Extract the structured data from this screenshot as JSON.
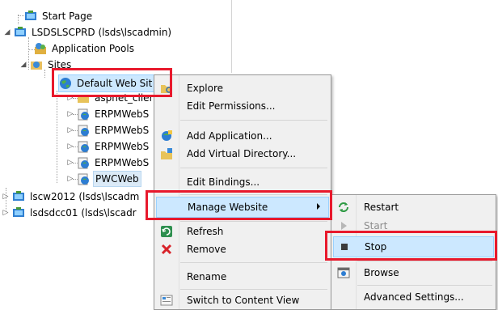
{
  "tree": {
    "start_page": "Start Page",
    "server": "LSDSLSCPRD (lsds\\lscadmin)",
    "app_pools": "Application Pools",
    "sites": "Sites",
    "default_site": "Default Web Sit",
    "child_aspnet": "aspnet_clier",
    "erpm1": "ERPMWebS",
    "erpm2": "ERPMWebS",
    "erpm3": "ERPMWebS",
    "erpm4": "ERPMWebS",
    "pwc": "PWCWeb",
    "server2": "lscw2012 (lsds\\lscadm",
    "server3": "lsdsdcc01 (lsds\\lscadr"
  },
  "context_menu": {
    "explore": "Explore",
    "edit_permissions": "Edit Permissions...",
    "add_application": "Add Application...",
    "add_virtual_directory": "Add Virtual Directory...",
    "edit_bindings": "Edit Bindings...",
    "manage_website": "Manage Website",
    "refresh": "Refresh",
    "remove": "Remove",
    "rename": "Rename",
    "switch_content_view": "Switch to Content View"
  },
  "submenu": {
    "restart": "Restart",
    "start": "Start",
    "stop": "Stop",
    "browse": "Browse",
    "advanced_settings": "Advanced Settings..."
  },
  "colors": {
    "highlight_box": "#e8192c",
    "selection_bg": "#cce8ff",
    "menu_bg": "#f0f0f0"
  }
}
